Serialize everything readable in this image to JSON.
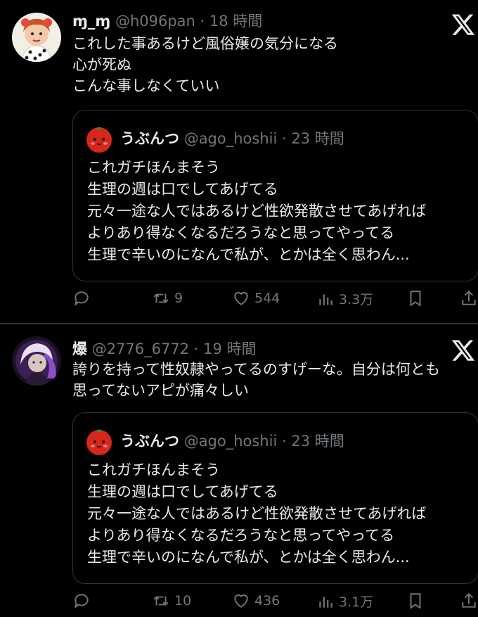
{
  "tweets": [
    {
      "name": "ɱ_ɱ",
      "handle": "@h096pan · 18 時間",
      "text": "これした事あるけど風俗嬢の気分になる\n心が死ぬ\nこんな事しなくていい",
      "quote": {
        "name": "うぶんつ",
        "handle": "@ago_hoshii · 23 時間",
        "text": "これガチほんまそう\n生理の週は口でしてあげてる\n元々一途な人ではあるけど性欲発散させてあげれば\nよりあり得なくなるだろうなと思ってやってる\n生理で辛いのになんで私が、とかは全く思わん..."
      },
      "actions": {
        "reply": "",
        "retweet": "9",
        "like": "544",
        "views": "3.3万"
      }
    },
    {
      "name": "爆",
      "handle": "@2776_6772 · 19 時間",
      "text": "誇りを持って性奴隷やってるのすげーな。自分は何とも\n思ってないアピが痛々しい",
      "quote": {
        "name": "うぶんつ",
        "handle": "@ago_hoshii · 23 時間",
        "text": "これガチほんまそう\n生理の週は口でしてあげてる\n元々一途な人ではあるけど性欲発散させてあげれば\nよりあり得なくなるだろうなと思ってやってる\n生理で辛いのになんで私が、とかは全く思わん..."
      },
      "actions": {
        "reply": "",
        "retweet": "10",
        "like": "436",
        "views": "3.1万"
      }
    }
  ],
  "icons": [
    "x-logo-icon",
    "reply-icon",
    "retweet-icon",
    "like-icon",
    "views-icon",
    "bookmark-icon",
    "share-icon"
  ],
  "colors": {
    "background": "#000000",
    "text": "#e7e9ea",
    "muted": "#71767b",
    "border": "#2f3336",
    "quote_avatar_red": "#d9261c"
  }
}
